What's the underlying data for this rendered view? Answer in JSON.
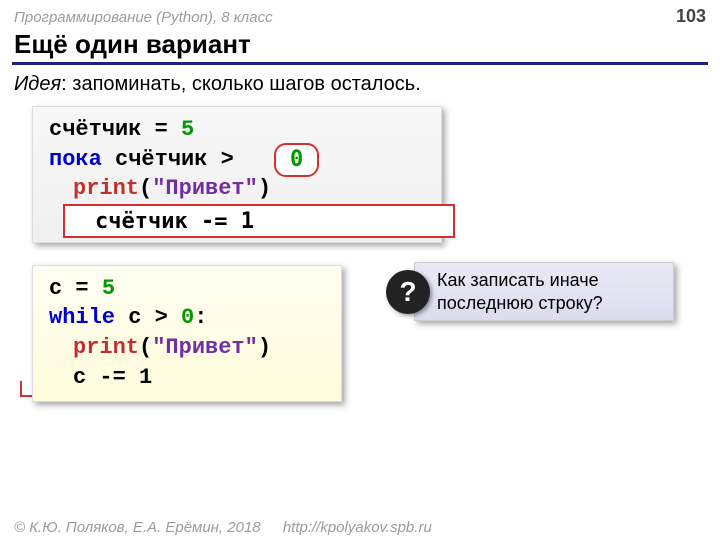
{
  "header": {
    "course": "Программирование (Python), 8 класс",
    "page": "103"
  },
  "title": "Ещё один вариант",
  "idea": {
    "label": "Идея",
    "text": ": запоминать, сколько шагов осталось."
  },
  "code_pseudo": {
    "l1a": "счётчик",
    "l1b": " = ",
    "l1c": "5",
    "l2a": "пока",
    "l2b": " счётчик > ",
    "zero": "0",
    "l3a": "print",
    "l3b": "(",
    "l3c": "\"Привет\"",
    "l3d": ")",
    "l4": "счётчик -= 1"
  },
  "code_py": {
    "l1a": "c = ",
    "l1b": "5",
    "l2a": "while",
    "l2b": " c > ",
    "l2c": "0",
    "l2d": ":",
    "l3a": "print",
    "l3b": "(",
    "l3c": "\"Привет\"",
    "l3d": ")",
    "l4": "c -= 1"
  },
  "question": {
    "mark": "?",
    "text1": "Как записать иначе",
    "text2": "последнюю строку?"
  },
  "footer": {
    "copyright": "© К.Ю. Поляков, Е.А. Ерёмин, 2018",
    "url": "http://kpolyakov.spb.ru"
  }
}
